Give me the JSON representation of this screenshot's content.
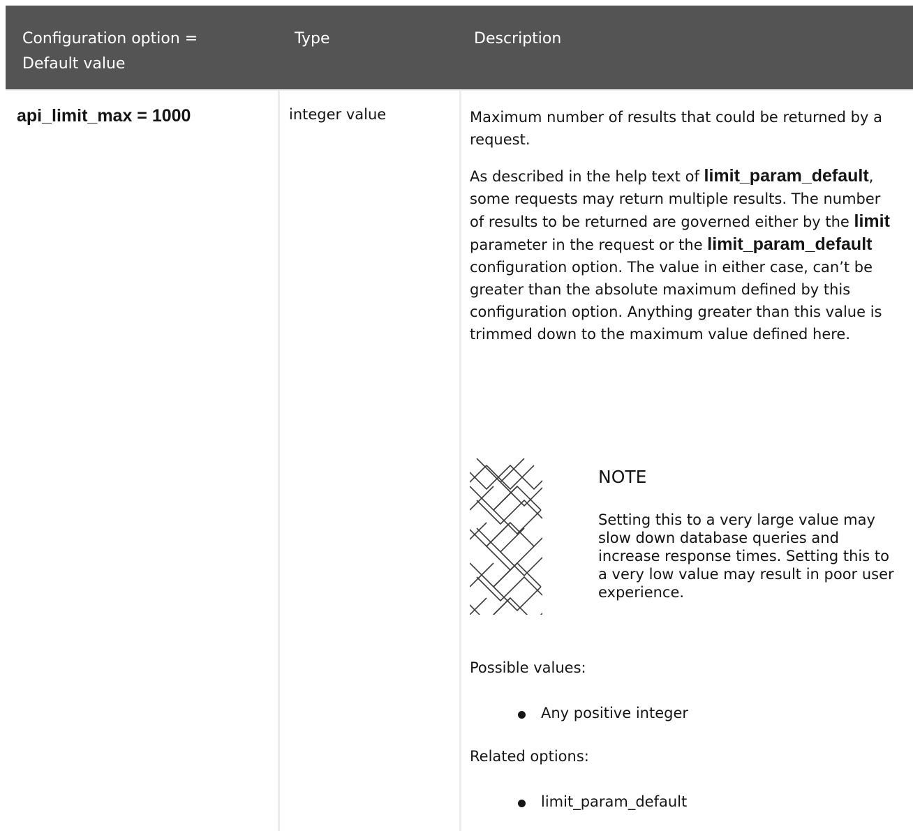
{
  "table": {
    "headers": [
      "Configuration option = Default value",
      "Type",
      "Description"
    ],
    "row": {
      "option": "api_limit_max = 1000",
      "type": "integer value",
      "desc_p1": "Maximum number of results that could be returned by a request.",
      "desc_p2_before": "As described in the help text of ",
      "desc_p2_bold1": "limit_param_default",
      "desc_p2_mid1": ", some requests may return multiple results. The number of results to be returned are governed either by the ",
      "desc_p2_bold2": "limit",
      "desc_p2_mid2": " parameter in the request or the ",
      "desc_p2_bold3": "limit_param_default",
      "desc_p2_after": " configuration option. The value in either case, can’t be greater than the absolute maximum defined by this configuration option. Anything greater than this value is trimmed down to the maximum value defined here.",
      "note_title": "NOTE",
      "note_text": "Setting this to a very large value may slow down database queries and increase response times. Setting this to a very low value may result in poor user experience.",
      "possible_values_label": "Possible values:",
      "possible_values": [
        "Any positive integer"
      ],
      "related_options_label": "Related options:",
      "related_options": [
        "limit_param_default"
      ]
    }
  },
  "colors": {
    "header_bg": "#545454",
    "header_text": "#ffffff",
    "divider": "#ececec",
    "text": "#151515"
  },
  "icons": {
    "note": "note-pattern-icon"
  }
}
